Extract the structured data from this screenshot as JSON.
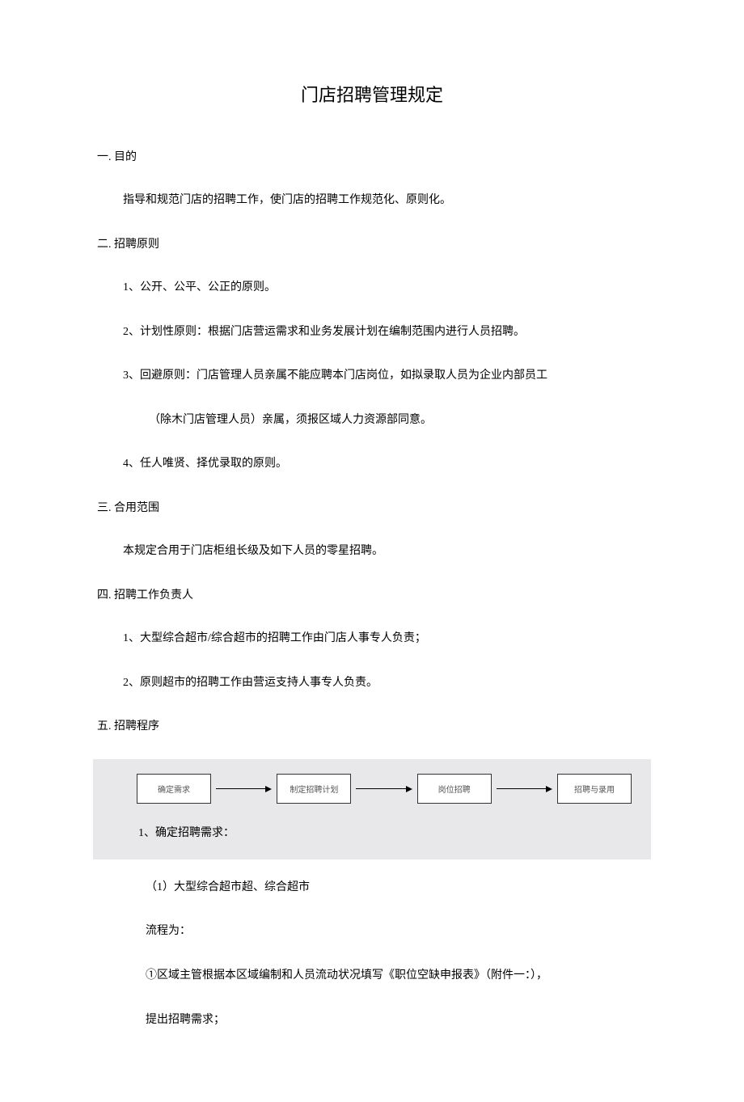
{
  "title": "门店招聘管理规定",
  "section1": {
    "heading": "一. 目的",
    "text": "指导和规范门店的招聘工作，使门店的招聘工作规范化、原则化。"
  },
  "section2": {
    "heading": "二. 招聘原则",
    "items": {
      "i1": "1、公开、公平、公正的原则。",
      "i2": "2、计划性原则：根据门店营运需求和业务发展计划在编制范围内进行人员招聘。",
      "i3a": "3、回避原则：门店管理人员亲属不能应聘本门店岗位，如拟录取人员为企业内部员工",
      "i3b": "（除木门店管理人员）亲属，须报区域人力资源部同意。",
      "i4": "4、任人唯贤、择优录取的原则。"
    }
  },
  "section3": {
    "heading": "三. 合用范围",
    "text": "本规定合用于门店柜组长级及如下人员的零星招聘。"
  },
  "section4": {
    "heading": "四. 招聘工作负责人",
    "items": {
      "i1": "1、大型综合超市/综合超市的招聘工作由门店人事专人负责；",
      "i2": "2、原则超市的招聘工作由营运支持人事专人负责。"
    }
  },
  "section5": {
    "heading": "五. 招聘程序",
    "flow": {
      "b1": "确定需求",
      "b2": "制定招聘计划",
      "b3": "岗位招聘",
      "b4": "招聘与录用"
    },
    "step1": "1、确定招聘需求：",
    "sub1": "（1）大型综合超市超、综合超市",
    "sub2": "流程为：",
    "sub3": "①区域主管根据本区域编制和人员流动状况填写《职位空缺申报表》（附件一：），",
    "sub4": "提出招聘需求；"
  }
}
